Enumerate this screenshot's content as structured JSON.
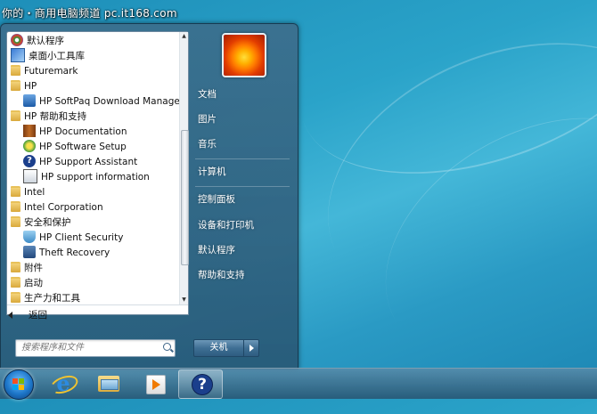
{
  "watermark": "你的・商用电脑频道 pc.it168.com",
  "programs": [
    {
      "label": "默认程序",
      "icon": "default-programs-icon",
      "indent": 0
    },
    {
      "label": "桌面小工具库",
      "icon": "gadgets-icon",
      "indent": 0
    },
    {
      "label": "Futuremark",
      "icon": "folder-icon",
      "indent": 0
    },
    {
      "label": "HP",
      "icon": "folder-icon",
      "indent": 0
    },
    {
      "label": "HP SoftPaq Download Manager",
      "icon": "hp-softpaq-icon",
      "indent": 1
    },
    {
      "label": "HP 帮助和支持",
      "icon": "folder-icon",
      "indent": 0
    },
    {
      "label": "HP Documentation",
      "icon": "books-icon",
      "indent": 1
    },
    {
      "label": "HP Software Setup",
      "icon": "software-setup-icon",
      "indent": 1
    },
    {
      "label": "HP Support Assistant",
      "icon": "help-question-icon",
      "indent": 1
    },
    {
      "label": "HP support information",
      "icon": "document-icon",
      "indent": 1
    },
    {
      "label": "Intel",
      "icon": "folder-icon",
      "indent": 0
    },
    {
      "label": "Intel Corporation",
      "icon": "folder-icon",
      "indent": 0
    },
    {
      "label": "安全和保护",
      "icon": "folder-icon",
      "indent": 0
    },
    {
      "label": "HP Client Security",
      "icon": "shield-check-icon",
      "indent": 1
    },
    {
      "label": "Theft Recovery",
      "icon": "padlock-icon",
      "indent": 1
    },
    {
      "label": "附件",
      "icon": "folder-icon",
      "indent": 0
    },
    {
      "label": "启动",
      "icon": "folder-icon",
      "indent": 0
    },
    {
      "label": "生产力和工具",
      "icon": "folder-icon",
      "indent": 0
    }
  ],
  "back_label": "返回",
  "search": {
    "placeholder": "搜索程序和文件"
  },
  "right_menu": {
    "documents": "文档",
    "pictures": "图片",
    "music": "音乐",
    "computer": "计算机",
    "control_panel": "控制面板",
    "devices_printers": "设备和打印机",
    "default_programs": "默认程序",
    "help_support": "帮助和支持"
  },
  "shutdown_label": "关机",
  "taskbar": {
    "items": [
      "internet-explorer-icon",
      "windows-explorer-icon",
      "media-player-icon",
      "help-support-icon"
    ]
  },
  "colors": {
    "accent": "#2aa3c9",
    "menu_panel": "#3c6e8c"
  }
}
